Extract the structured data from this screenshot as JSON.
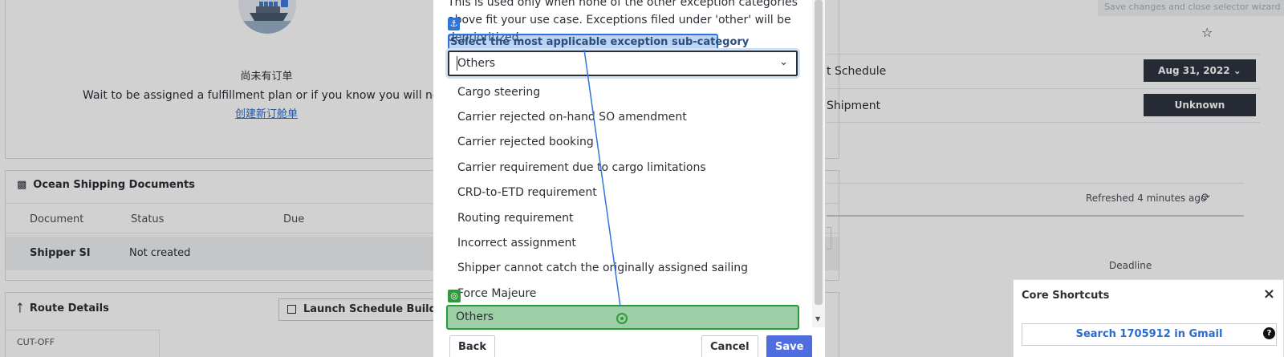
{
  "background": {
    "empty_state": {
      "title": "尚未有订单",
      "text": "Wait to be assigned a fulfillment plan or if you know you will not get one",
      "link": "创建新订舱单"
    },
    "docs": {
      "title": "Ocean Shipping Documents",
      "columns": [
        "Document",
        "Status",
        "Due"
      ],
      "row": {
        "document": "Shipper SI",
        "status": "Not created"
      }
    },
    "route": {
      "title": "Route Details",
      "launch_label": "Launch Schedule Builder",
      "cutoff_label": "CUT-OFF"
    },
    "right": {
      "save_hint": "Save changes and close selector wizard",
      "rows": [
        {
          "label": "t Schedule",
          "value": "Aug 31, 2022 ⌄"
        },
        {
          "label": "Shipment",
          "value": "Unknown"
        }
      ],
      "refreshed": "Refreshed 4 minutes ago",
      "deadline": "Deadline"
    }
  },
  "modal": {
    "help_text": "This is used only when none of the other exception categories above fit your use case. Exceptions filed under 'other' will be deprioritized.",
    "sub_category_label": "Select the most applicable exception sub-category",
    "selected_value": "Others",
    "options": [
      "Cargo steering",
      "Carrier rejected on-hand SO amendment",
      "Carrier rejected booking",
      "Carrier requirement due to cargo limitations",
      "CRD-to-ETD requirement",
      "Routing requirement",
      "Incorrect assignment",
      "Shipper cannot catch the originally assigned sailing",
      "Force Majeure",
      "Others"
    ],
    "buttons": {
      "back": "Back",
      "cancel": "Cancel",
      "save": "Save"
    }
  },
  "shortcuts": {
    "title": "Core Shortcuts",
    "gmail_label": "Search 1705912 in Gmail"
  }
}
